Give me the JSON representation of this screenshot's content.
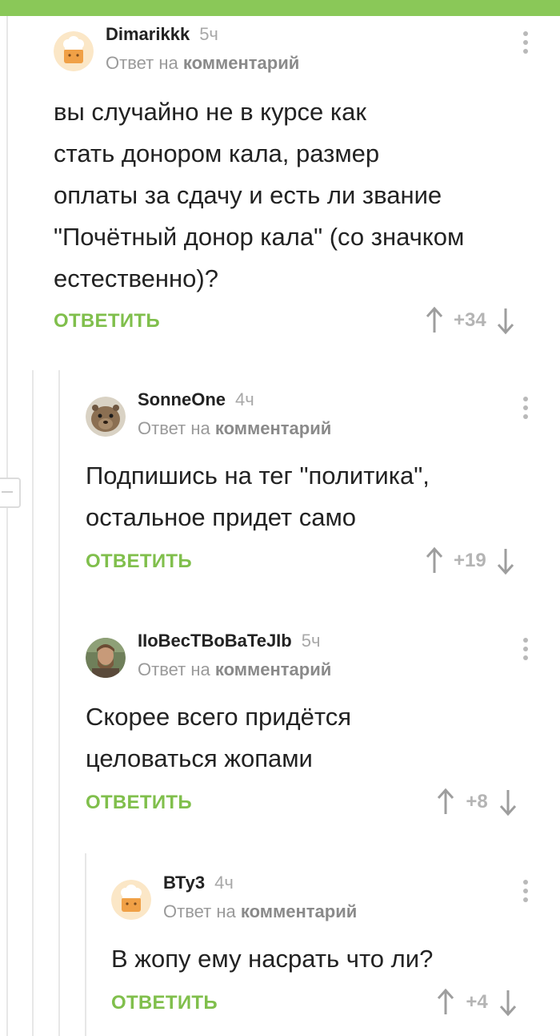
{
  "comments": [
    {
      "username": "Dimarikkk",
      "time": "5ч",
      "reply_prefix": "Ответ на",
      "reply_target": "комментарий",
      "text": [
        "вы случайно не в курсе как",
        "стать донором кала, размер",
        "оплаты за сдачу и есть ли звание",
        "\"Почётный донор кала\" (со значком",
        "естественно)?"
      ],
      "reply_label": "ОТВЕТИТЬ",
      "score": "+34",
      "avatar": "default-avatar"
    },
    {
      "username": "SonneOne",
      "time": "4ч",
      "reply_prefix": "Ответ на",
      "reply_target": "комментарий",
      "text": [
        "Подпишись на тег \"политика\",",
        "остальное придет само"
      ],
      "reply_label": "ОТВЕТИТЬ",
      "score": "+19",
      "avatar": "hyrax-photo"
    },
    {
      "username": "IIoBecTBoBaTeJIb",
      "time": "5ч",
      "reply_prefix": "Ответ на",
      "reply_target": "комментарий",
      "text": [
        "Скорее всего придётся",
        "целоваться жопами"
      ],
      "reply_label": "ОТВЕТИТЬ",
      "score": "+8",
      "avatar": "man-photo"
    },
    {
      "username": "ВТу3",
      "time": "4ч",
      "reply_prefix": "Ответ на",
      "reply_target": "комментарий",
      "text": [
        "В жопу ему насрать что ли?"
      ],
      "reply_label": "ОТВЕТИТЬ",
      "score": "+4",
      "avatar": "default-avatar"
    }
  ],
  "colors": {
    "accent_green": "#80bf4c",
    "top_bar": "#8ac858",
    "muted_text": "#9a9a9a",
    "score": "#b4b4b4"
  },
  "icons": [
    "more-vertical-icon",
    "arrow-up-icon",
    "arrow-down-icon",
    "collapse-thread-icon"
  ]
}
